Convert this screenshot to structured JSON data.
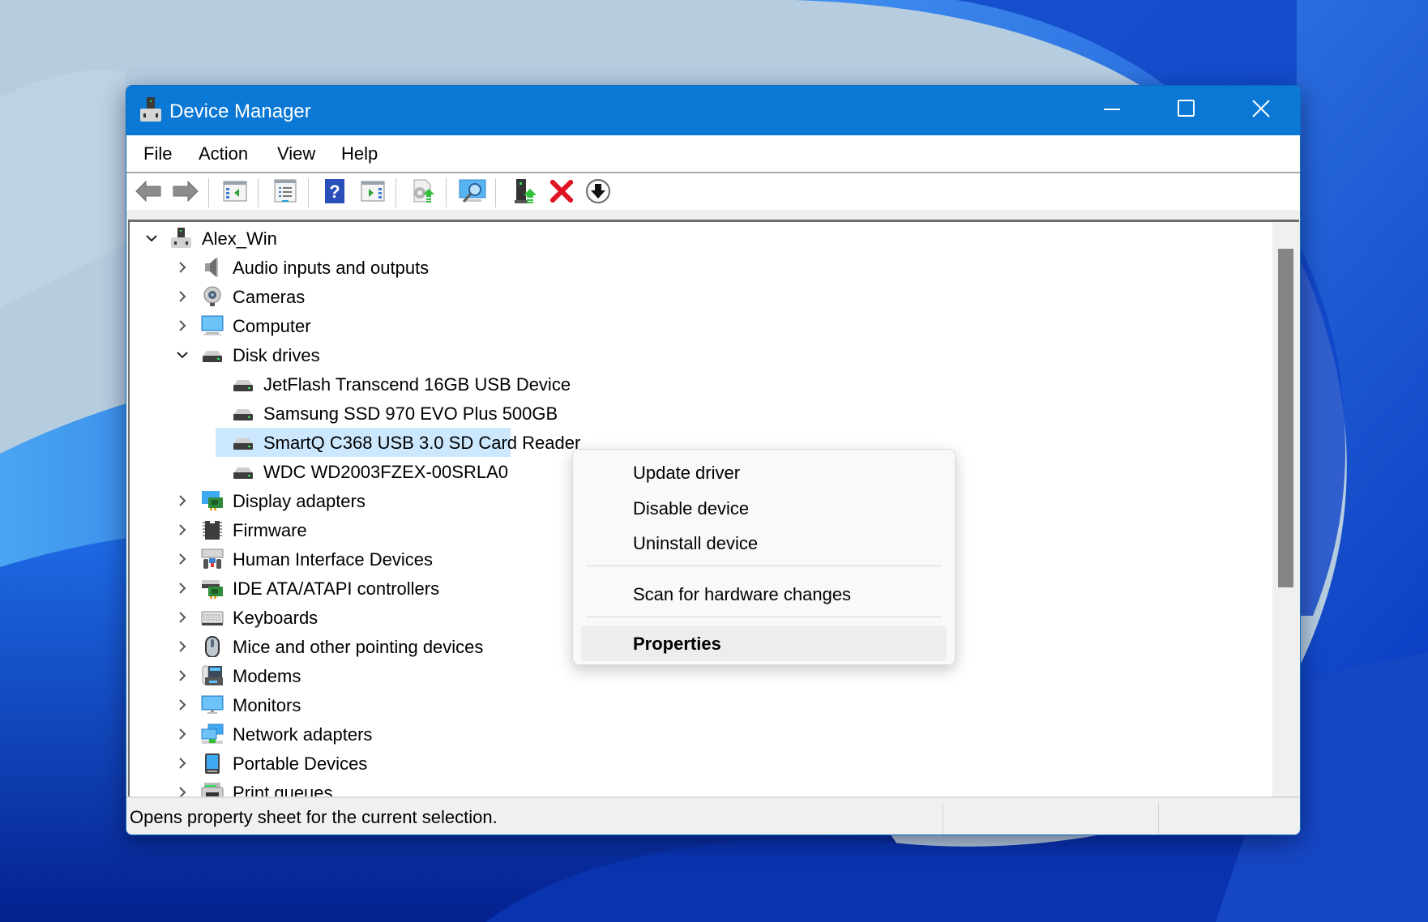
{
  "window": {
    "title": "Device Manager",
    "controls": {
      "minimize": "minimize",
      "maximize": "maximize",
      "close": "close"
    }
  },
  "menubar": {
    "items": [
      "File",
      "Action",
      "View",
      "Help"
    ]
  },
  "toolbar": {
    "buttons": [
      {
        "name": "back",
        "icon": "arrow-left-icon"
      },
      {
        "name": "forward",
        "icon": "arrow-right-icon"
      },
      {
        "name": "show-hide-console-tree",
        "icon": "console-tree-icon"
      },
      {
        "name": "properties",
        "icon": "properties-sheet-icon"
      },
      {
        "name": "help",
        "icon": "help-icon"
      },
      {
        "name": "show-hide-action-pane",
        "icon": "action-pane-icon"
      },
      {
        "name": "update-driver",
        "icon": "update-driver-icon"
      },
      {
        "name": "scan-hardware-changes",
        "icon": "scan-monitor-icon"
      },
      {
        "name": "add-legacy-hardware",
        "icon": "add-device-icon"
      },
      {
        "name": "uninstall-device",
        "icon": "red-x-icon"
      },
      {
        "name": "disable-device",
        "icon": "down-arrow-circle-icon"
      }
    ]
  },
  "tree": {
    "root": {
      "label": "Alex_Win",
      "expanded": true
    },
    "rows": [
      {
        "label": "Audio inputs and outputs",
        "level": 1,
        "expander": "collapsed",
        "icon": "speaker-icon"
      },
      {
        "label": "Cameras",
        "level": 1,
        "expander": "collapsed",
        "icon": "webcam-icon"
      },
      {
        "label": "Computer",
        "level": 1,
        "expander": "collapsed",
        "icon": "computer-monitor-icon"
      },
      {
        "label": "Disk drives",
        "level": 1,
        "expander": "expanded",
        "icon": "disk-drive-icon"
      },
      {
        "label": "JetFlash Transcend 16GB USB Device",
        "level": 2,
        "expander": "none",
        "icon": "disk-drive-icon"
      },
      {
        "label": "Samsung SSD 970 EVO Plus 500GB",
        "level": 2,
        "expander": "none",
        "icon": "disk-drive-icon"
      },
      {
        "label": "SmartQ C368 USB 3.0 SD Card Reader",
        "level": 2,
        "expander": "none",
        "icon": "disk-drive-icon",
        "selected": true
      },
      {
        "label": "WDC WD2003FZEX-00SRLA0",
        "level": 2,
        "expander": "none",
        "icon": "disk-drive-icon"
      },
      {
        "label": "Display adapters",
        "level": 1,
        "expander": "collapsed",
        "icon": "display-adapter-icon"
      },
      {
        "label": "Firmware",
        "level": 1,
        "expander": "collapsed",
        "icon": "chip-icon"
      },
      {
        "label": "Human Interface Devices",
        "level": 1,
        "expander": "collapsed",
        "icon": "hid-icon"
      },
      {
        "label": "IDE ATA/ATAPI controllers",
        "level": 1,
        "expander": "collapsed",
        "icon": "ide-controller-icon"
      },
      {
        "label": "Keyboards",
        "level": 1,
        "expander": "collapsed",
        "icon": "keyboard-icon"
      },
      {
        "label": "Mice and other pointing devices",
        "level": 1,
        "expander": "collapsed",
        "icon": "mouse-icon"
      },
      {
        "label": "Modems",
        "level": 1,
        "expander": "collapsed",
        "icon": "modem-icon"
      },
      {
        "label": "Monitors",
        "level": 1,
        "expander": "collapsed",
        "icon": "monitor-icon"
      },
      {
        "label": "Network adapters",
        "level": 1,
        "expander": "collapsed",
        "icon": "network-adapter-icon"
      },
      {
        "label": "Portable Devices",
        "level": 1,
        "expander": "collapsed",
        "icon": "portable-device-icon"
      },
      {
        "label": "Print queues",
        "level": 1,
        "expander": "collapsed",
        "icon": "printer-icon"
      }
    ]
  },
  "context_menu": {
    "items": [
      {
        "label": "Update driver"
      },
      {
        "label": "Disable device"
      },
      {
        "label": "Uninstall device"
      },
      {
        "separator": true
      },
      {
        "label": "Scan for hardware changes"
      },
      {
        "separator": true
      },
      {
        "label": "Properties",
        "bold": true,
        "hovered": true
      }
    ]
  },
  "statusbar": {
    "text": "Opens property sheet for the current selection."
  },
  "colors": {
    "titlebar": "#0a78d4",
    "selection": "#cce8ff",
    "desktop": "#b6cde0"
  }
}
